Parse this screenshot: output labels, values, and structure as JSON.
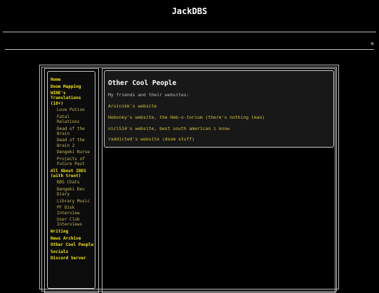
{
  "site": {
    "title": "JackDBS",
    "corner_mark": "N"
  },
  "nav": {
    "items": [
      {
        "label": "Home",
        "level": 0
      },
      {
        "label": "Doom Mapping",
        "level": 0
      },
      {
        "label": "WINE's Translations (18+)",
        "level": 0
      },
      {
        "label": "Love Potion",
        "level": 1
      },
      {
        "label": "Fatal Relations",
        "level": 1
      },
      {
        "label": "Dead of the Brain",
        "level": 1
      },
      {
        "label": "Dead of the Brain 2",
        "level": 1
      },
      {
        "label": "Dengeki Nurse",
        "level": 1
      },
      {
        "label": "Projects of Future Past",
        "level": 1
      },
      {
        "label": "All About IDES (with trent)",
        "level": 0
      },
      {
        "label": "BBS Chats",
        "level": 1
      },
      {
        "label": "Dengeki Dev Diary",
        "level": 1
      },
      {
        "label": "Library Music",
        "level": 1
      },
      {
        "label": "PF Disk Interview",
        "level": 1
      },
      {
        "label": "User Club Interviews",
        "level": 1
      },
      {
        "label": "Writing",
        "level": 0
      },
      {
        "label": "News Archive",
        "level": 0
      },
      {
        "label": "Other Cool People",
        "level": 0
      },
      {
        "label": "Socials",
        "level": 0
      },
      {
        "label": "Discord Server",
        "level": 0
      }
    ]
  },
  "main": {
    "heading": "Other Cool People",
    "intro": "My friends and their websites:",
    "links": [
      "Arsinikk's website",
      "Hebonky's website, the Heb-o-torium (there's nothing lmao)",
      "nicl514's website, best south american i know",
      "raddicted's website (doom stuff)"
    ]
  },
  "colors": {
    "background": "#000000",
    "nav_link": "#f2e21a",
    "sub_link": "#c8b85a",
    "content_link": "#d4c23c",
    "heading": "#ffffff"
  }
}
